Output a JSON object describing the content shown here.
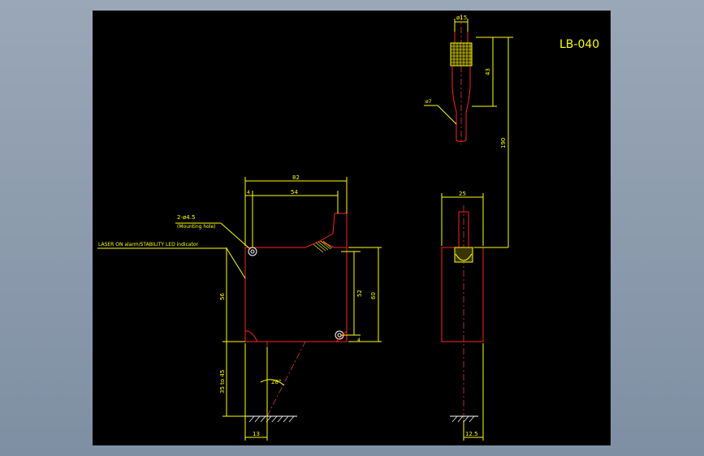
{
  "drawing": {
    "title": "LB-040",
    "colors": {
      "background": "#000000",
      "dimension": "#ffff00",
      "outline": "#ff2020",
      "frame": "#8896a8"
    }
  },
  "connector": {
    "dia_top": "ø15",
    "len_43": "43",
    "cable_dia": "ø7",
    "len_190": "190"
  },
  "front_view": {
    "dim_82": "82",
    "dim_4": "4",
    "dim_54": "54",
    "hole_label": "2-ø4.5",
    "hole_note": "(Mounting hole)",
    "indicator_label": "LASER ON alarm/STABILITY LED indicator",
    "dim_56": "56",
    "dim_52": "52",
    "dim_60": "60",
    "dim_4b": "4",
    "dim_35_45": "35 to 45",
    "angle": "28°",
    "dim_13": "13"
  },
  "side_view": {
    "dim_25": "25",
    "dim_12_5": "12.5"
  }
}
